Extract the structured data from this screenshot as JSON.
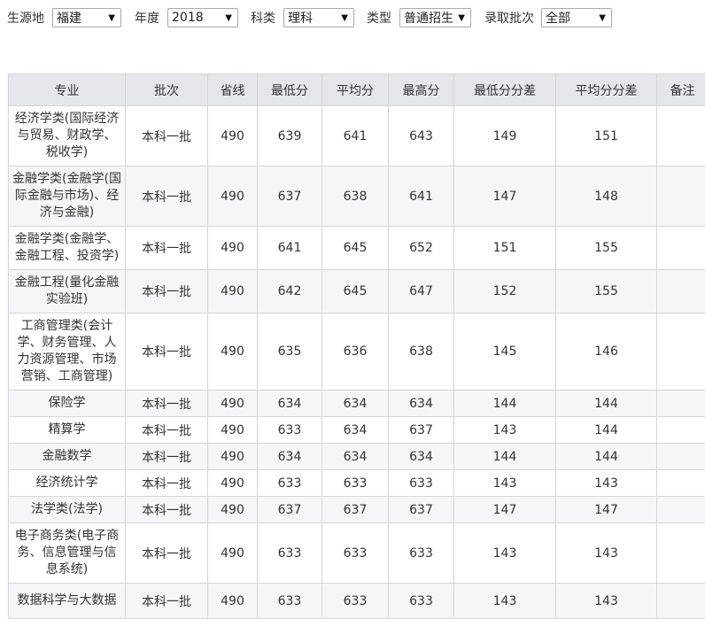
{
  "filters": [
    {
      "label": "生源地",
      "value": "福建"
    },
    {
      "label": "年度",
      "value": "2018"
    },
    {
      "label": "科类",
      "value": "理科"
    },
    {
      "label": "类型",
      "value": "普通招生"
    },
    {
      "label": "录取批次",
      "value": "全部"
    }
  ],
  "table": {
    "headers": [
      "专业",
      "批次",
      "省线",
      "最低分",
      "平均分",
      "最高分",
      "最低分分差",
      "平均分分差",
      "备注"
    ],
    "rows": [
      {
        "major": "经济学类(国际经济与贸易、财政学、税收学)",
        "batch": "本科一批",
        "line": "490",
        "min": "639",
        "avg": "641",
        "max": "643",
        "min_diff": "149",
        "avg_diff": "151",
        "note": ""
      },
      {
        "major": "金融学类(金融学(国际金融与市场)、经济与金融)",
        "batch": "本科一批",
        "line": "490",
        "min": "637",
        "avg": "638",
        "max": "641",
        "min_diff": "147",
        "avg_diff": "148",
        "note": ""
      },
      {
        "major": "金融学类(金融学、金融工程、投资学)",
        "batch": "本科一批",
        "line": "490",
        "min": "641",
        "avg": "645",
        "max": "652",
        "min_diff": "151",
        "avg_diff": "155",
        "note": ""
      },
      {
        "major": "金融工程(量化金融实验班)",
        "batch": "本科一批",
        "line": "490",
        "min": "642",
        "avg": "645",
        "max": "647",
        "min_diff": "152",
        "avg_diff": "155",
        "note": ""
      },
      {
        "major": "工商管理类(会计学、财务管理、人力资源管理、市场营销、工商管理)",
        "batch": "本科一批",
        "line": "490",
        "min": "635",
        "avg": "636",
        "max": "638",
        "min_diff": "145",
        "avg_diff": "146",
        "note": ""
      },
      {
        "major": "保险学",
        "batch": "本科一批",
        "line": "490",
        "min": "634",
        "avg": "634",
        "max": "634",
        "min_diff": "144",
        "avg_diff": "144",
        "note": ""
      },
      {
        "major": "精算学",
        "batch": "本科一批",
        "line": "490",
        "min": "633",
        "avg": "634",
        "max": "637",
        "min_diff": "143",
        "avg_diff": "144",
        "note": ""
      },
      {
        "major": "金融数学",
        "batch": "本科一批",
        "line": "490",
        "min": "634",
        "avg": "634",
        "max": "634",
        "min_diff": "144",
        "avg_diff": "144",
        "note": ""
      },
      {
        "major": "经济统计学",
        "batch": "本科一批",
        "line": "490",
        "min": "633",
        "avg": "633",
        "max": "633",
        "min_diff": "143",
        "avg_diff": "143",
        "note": ""
      },
      {
        "major": "法学类(法学)",
        "batch": "本科一批",
        "line": "490",
        "min": "637",
        "avg": "637",
        "max": "637",
        "min_diff": "147",
        "avg_diff": "147",
        "note": ""
      },
      {
        "major": "电子商务类(电子商务、信息管理与信息系统)",
        "batch": "本科一批",
        "line": "490",
        "min": "633",
        "avg": "633",
        "max": "633",
        "min_diff": "143",
        "avg_diff": "143",
        "note": ""
      },
      {
        "major": "数据科学与大数据",
        "batch": "本科一批",
        "line": "490",
        "min": "633",
        "avg": "633",
        "max": "633",
        "min_diff": "143",
        "avg_diff": "143",
        "note": ""
      }
    ]
  }
}
